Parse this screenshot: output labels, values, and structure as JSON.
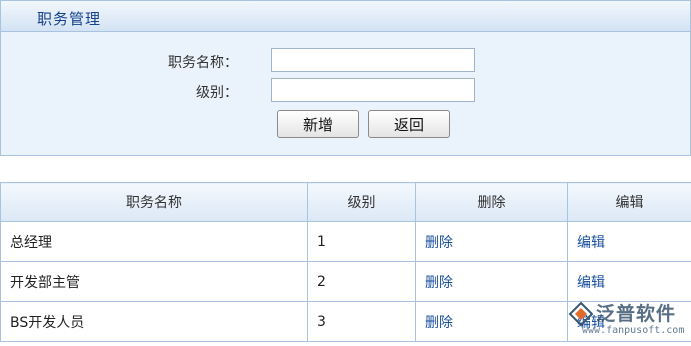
{
  "panel": {
    "title": "职务管理",
    "fields": {
      "name_label": "职务名称：",
      "name_value": "",
      "level_label": "级别：",
      "level_value": ""
    },
    "buttons": {
      "add": "新增",
      "back": "返回"
    }
  },
  "table": {
    "headers": [
      "职务名称",
      "级别",
      "删除",
      "编辑"
    ],
    "rows": [
      {
        "name": "总经理",
        "level": "1",
        "delete": "删除",
        "edit": "编辑"
      },
      {
        "name": "开发部主管",
        "level": "2",
        "delete": "删除",
        "edit": "编辑"
      },
      {
        "name": "BS开发人员",
        "level": "3",
        "delete": "删除",
        "edit": "编辑"
      }
    ]
  },
  "watermark": {
    "brand": "泛普软件",
    "url": "www.fanpusoft.com"
  },
  "colors": {
    "header_text": "#15428b",
    "link": "#1a4f9c",
    "border": "#a9c3de"
  }
}
